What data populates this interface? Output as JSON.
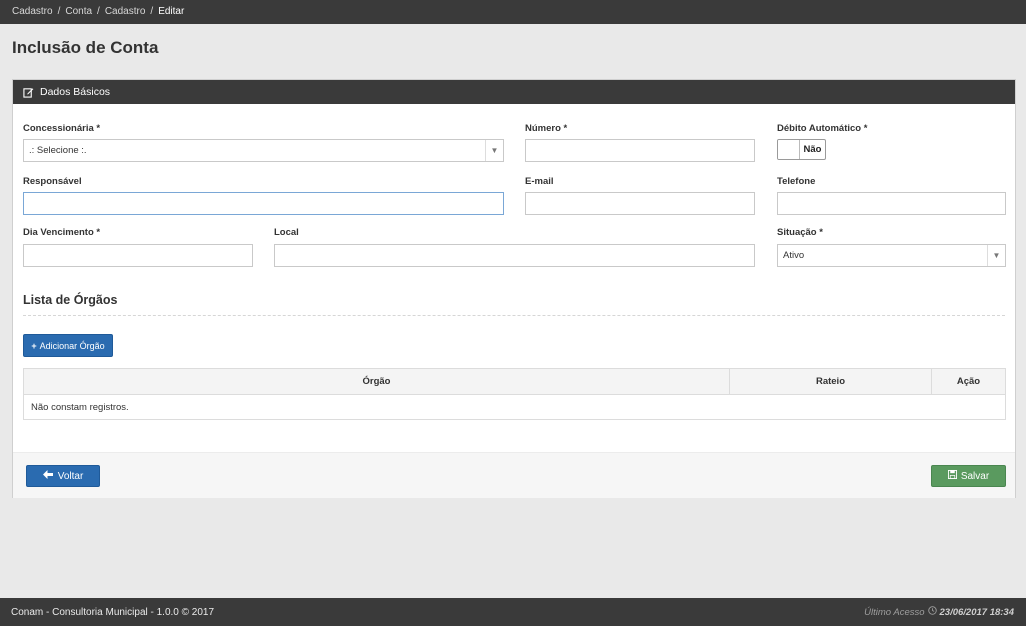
{
  "breadcrumb": [
    "Cadastro",
    "Conta",
    "Cadastro",
    "Editar"
  ],
  "breadcrumb_sep": "/",
  "page_title": "Inclusão de Conta",
  "panel": {
    "title": "Dados Básicos",
    "icon": "edit-icon"
  },
  "form": {
    "concessionaria": {
      "label": "Concessionária *",
      "value": ".: Selecione :."
    },
    "numero": {
      "label": "Número *",
      "value": ""
    },
    "debito": {
      "label": "Débito Automático *",
      "value": "Não"
    },
    "responsavel": {
      "label": "Responsável",
      "value": ""
    },
    "email": {
      "label": "E-mail",
      "value": ""
    },
    "telefone": {
      "label": "Telefone",
      "value": ""
    },
    "vencimento": {
      "label": "Dia Vencimento *",
      "value": ""
    },
    "local": {
      "label": "Local",
      "value": ""
    },
    "situacao": {
      "label": "Situação *",
      "value": "Ativo"
    }
  },
  "orgaos": {
    "title": "Lista de Órgãos",
    "add_button": "Adicionar Órgão",
    "columns": [
      "Órgão",
      "Rateio",
      "Ação"
    ],
    "empty_text": "Não constam registros."
  },
  "actions": {
    "back": "Voltar",
    "save": "Salvar"
  },
  "colors": {
    "primary": "#2a6bb0",
    "success": "#5a9a5f",
    "header": "#3a3a3a"
  },
  "footer": {
    "left": "Conam - Consultoria Municipal - 1.0.0 © 2017",
    "last_access_label": "Último Acesso",
    "last_access_value": "23/06/2017 18:34"
  }
}
